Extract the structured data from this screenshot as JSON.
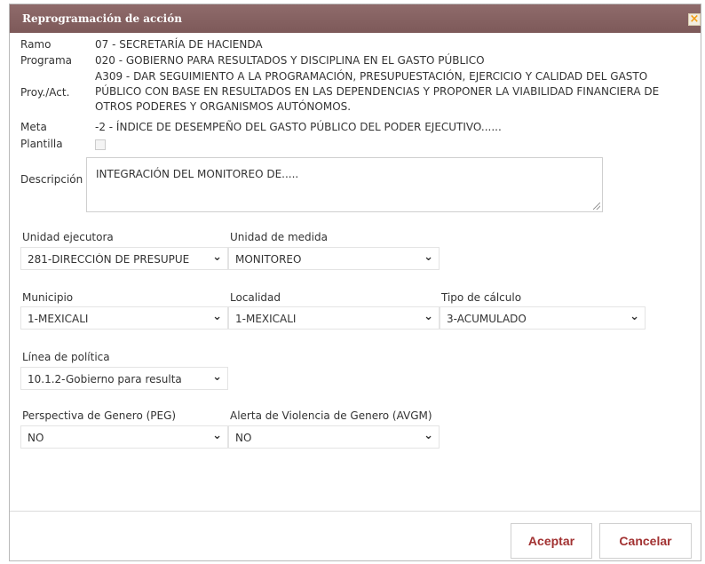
{
  "dialog": {
    "title": "Reprogramación de acción",
    "close_glyph": "×"
  },
  "info": {
    "ramo_label": "Ramo",
    "ramo_value": "07 - SECRETARÍA DE HACIENDA",
    "programa_label": "Programa",
    "programa_value": "020 - GOBIERNO PARA RESULTADOS Y DISCIPLINA EN EL GASTO PÚBLICO",
    "proy_label": "Proy./Act.",
    "proy_value_lines": [
      "A309 - DAR SEGUIMIENTO A LA PROGRAMACIÓN, PRESUPUESTACIÓN, EJERCICIO Y CALIDAD DEL GASTO",
      "PÚBLICO CON BASE EN RESULTADOS EN LAS DEPENDENCIAS Y PROPONER LA VIABILIDAD FINANCIERA DE",
      "OTROS PODERES Y ORGANISMOS AUTÓNOMOS."
    ],
    "meta_label": "Meta",
    "meta_value": "-2 - ÍNDICE DE DESEMPEÑO DEL GASTO PÚBLICO DEL PODER EJECUTIVO......",
    "plantilla_label": "Plantilla",
    "plantilla_checked": false
  },
  "descripcion": {
    "label": "Descripción",
    "value": "INTEGRACIÓN DEL MONITOREO DE....."
  },
  "fields": {
    "unidad_ejecutora": {
      "label": "Unidad ejecutora",
      "value": "281-DIRECCIÓN DE PRESUPUE"
    },
    "unidad_medida": {
      "label": "Unidad de medida",
      "value": "MONITOREO"
    },
    "municipio": {
      "label": "Municipio",
      "value": "1-MEXICALI"
    },
    "localidad": {
      "label": "Localidad",
      "value": "1-MEXICALI"
    },
    "tipo_calculo": {
      "label": "Tipo de cálculo",
      "value": "3-ACUMULADO"
    },
    "linea_politica": {
      "label": "Línea de política",
      "value": "10.1.2-Gobierno para resulta"
    },
    "peg": {
      "label": "Perspectiva de Genero (PEG)",
      "value": "NO"
    },
    "avgm": {
      "label": "Alerta de Violencia de Genero (AVGM)",
      "value": "NO"
    }
  },
  "chevron_glyph": "⌄",
  "buttons": {
    "aceptar": "Aceptar",
    "cancelar": "Cancelar"
  },
  "colors": {
    "title_bar": "#7d5959",
    "button_text": "#a23232",
    "close_icon": "#f39c12"
  }
}
